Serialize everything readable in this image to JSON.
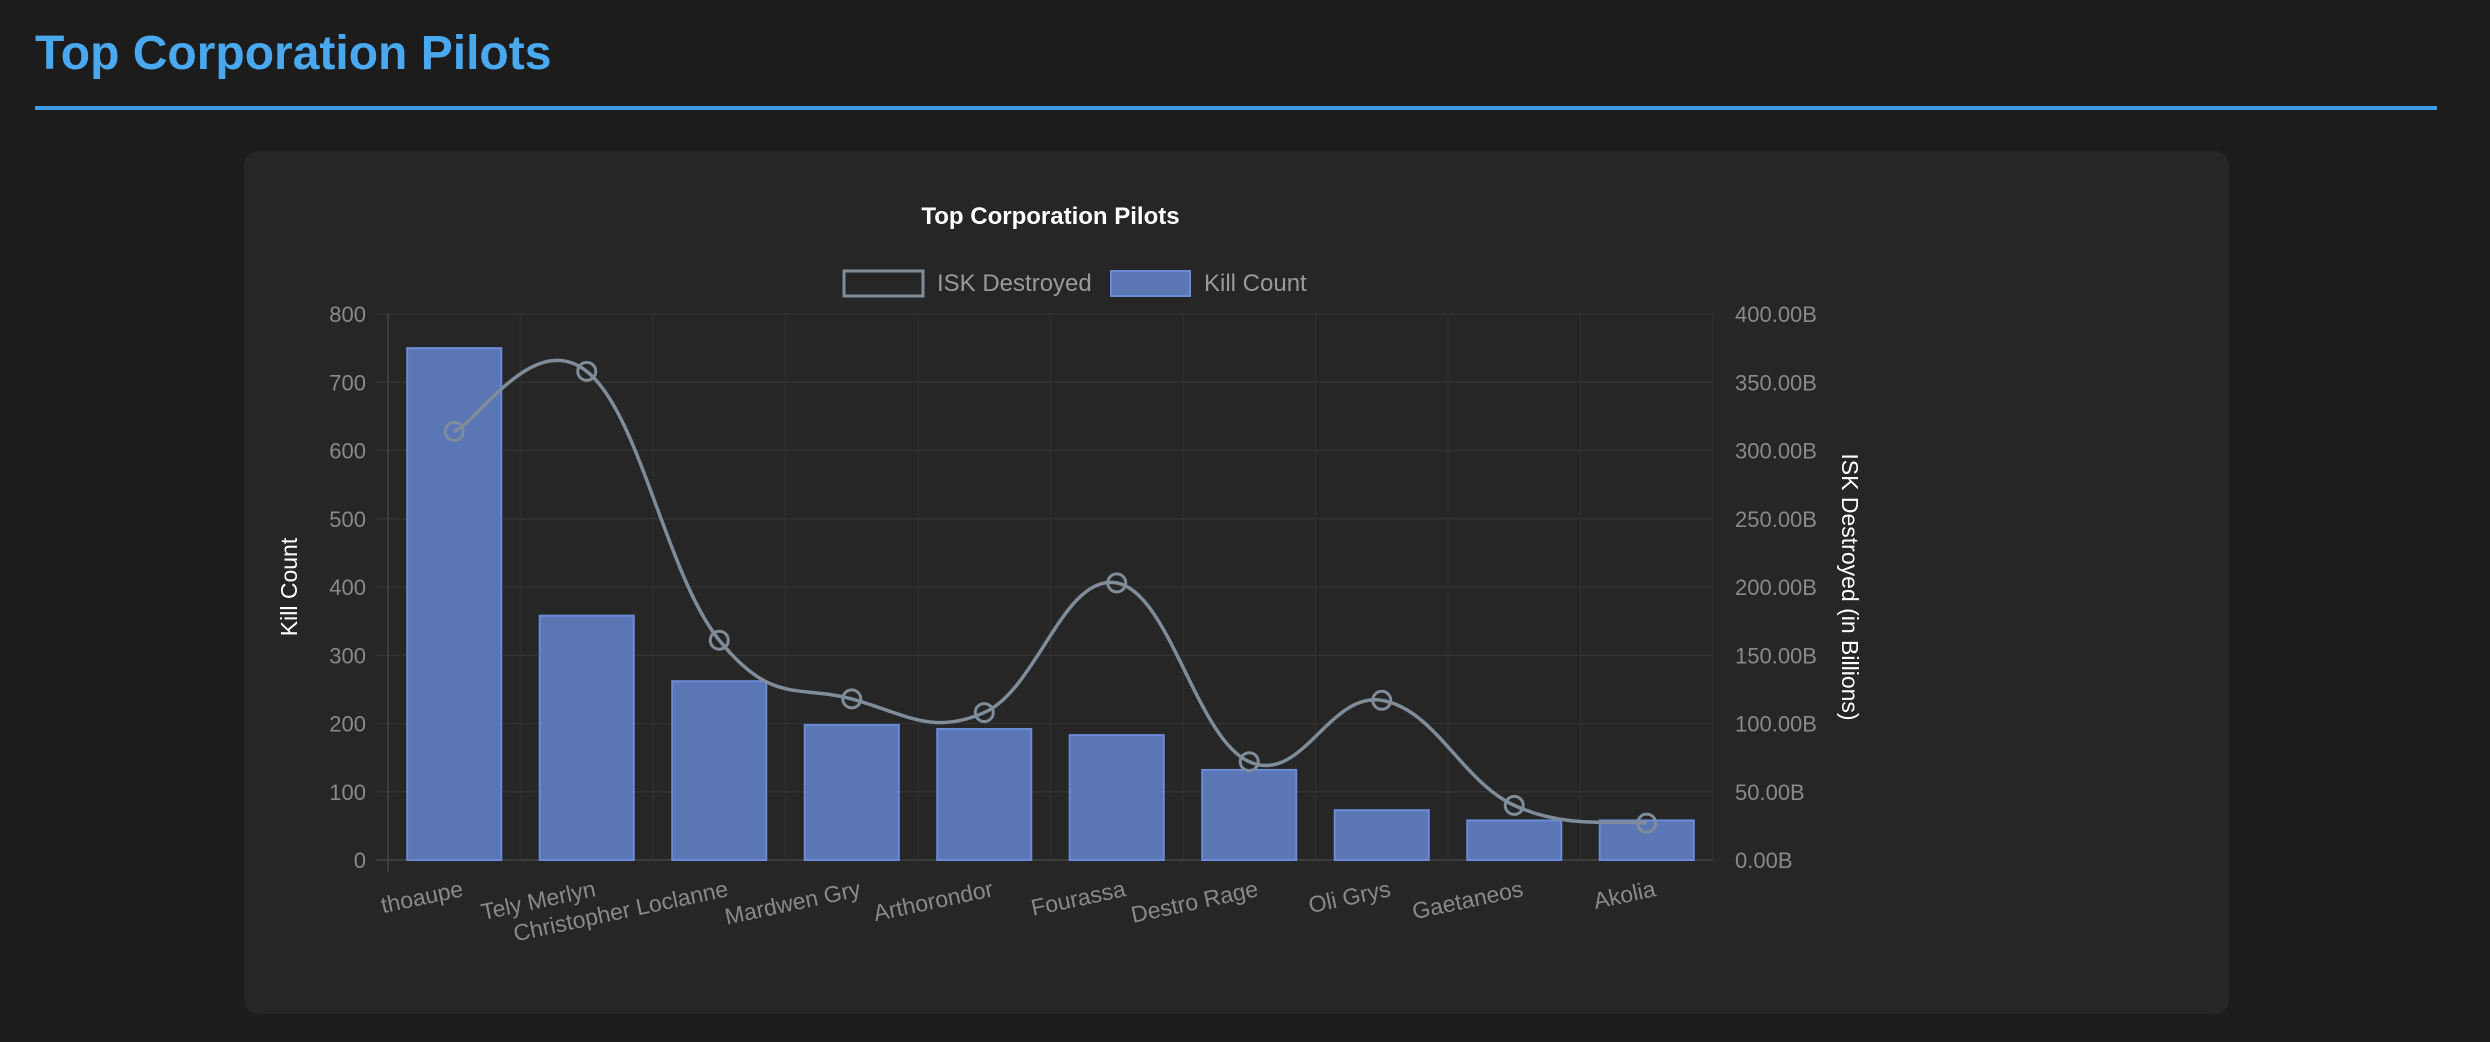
{
  "page": {
    "title": "Top Corporation Pilots"
  },
  "colors": {
    "accent": "#4aa8ef",
    "bar_fill": "#5b76b5",
    "bar_border": "#6b8ad8",
    "line": "#7f8c99",
    "card_bg": "#262626",
    "page_bg": "#1c1c1c"
  },
  "chart_data": {
    "type": "bar",
    "title": "Top Corporation Pilots",
    "categories": [
      "thoaupe",
      "Tely Merlyn",
      "Christopher Loclanne",
      "Mardwen Gry",
      "Arthorondor",
      "Fourassa",
      "Destro Rage",
      "Oli Grys",
      "Gaetaneos",
      "Akolia"
    ],
    "series": [
      {
        "name": "Kill Count",
        "type": "bar",
        "axis": "left",
        "values": [
          750,
          358,
          262,
          198,
          192,
          183,
          132,
          73,
          58,
          58
        ]
      },
      {
        "name": "ISK Destroyed",
        "type": "line",
        "axis": "right",
        "values": [
          314,
          358,
          161,
          118,
          108,
          203,
          72,
          117,
          40,
          27
        ]
      }
    ],
    "ylabel": "Kill Count",
    "y2label": "ISK Destroyed (in Billions)",
    "ylim": [
      0,
      800
    ],
    "y2lim": [
      0,
      400
    ],
    "yticks": [
      "0",
      "100",
      "200",
      "300",
      "400",
      "500",
      "600",
      "700",
      "800"
    ],
    "y2ticks": [
      "0.00B",
      "50.00B",
      "100.00B",
      "150.00B",
      "200.00B",
      "250.00B",
      "300.00B",
      "350.00B",
      "400.00B"
    ],
    "legend": "top",
    "grid": true
  }
}
